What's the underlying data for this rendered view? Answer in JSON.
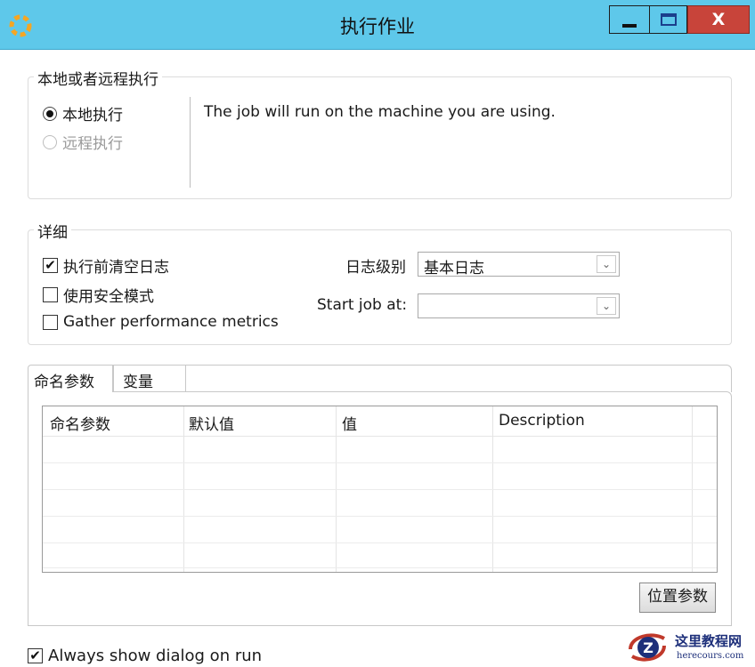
{
  "window": {
    "title": "执行作业",
    "close_label": "X"
  },
  "location_group": {
    "legend": "本地或者远程执行",
    "local_label": "本地执行",
    "remote_label": "远程执行",
    "local_selected": true,
    "description": "The job will run on the machine you are using."
  },
  "details_group": {
    "legend": "详细",
    "clear_log_label": "执行前清空日志",
    "clear_log_checked": true,
    "safe_mode_label": "使用安全模式",
    "safe_mode_checked": false,
    "metrics_label": "Gather performance metrics",
    "metrics_checked": false,
    "log_level_label": "日志级别",
    "log_level_value": "基本日志",
    "start_job_label": "Start job at:",
    "start_job_value": ""
  },
  "tabs": [
    {
      "label": "命名参数",
      "active": true
    },
    {
      "label": "变量",
      "active": false
    }
  ],
  "params_table": {
    "columns": [
      "命名参数",
      "默认值",
      "值",
      "Description"
    ],
    "rows": []
  },
  "position_params_button": "位置参数",
  "always_show": {
    "label": "Always show dialog on run",
    "checked": true
  },
  "watermark": {
    "title": "这里教程网",
    "url": "herecours.com"
  },
  "colors": {
    "titlebar": "#5ec8ea",
    "close": "#c8443a"
  }
}
